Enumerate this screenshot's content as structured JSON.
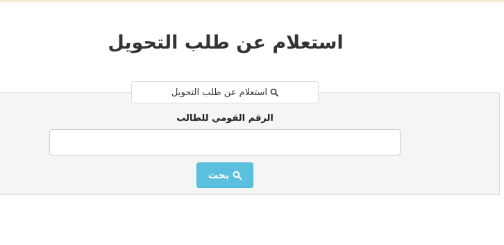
{
  "page": {
    "title": "استعلام عن طلب التحويل"
  },
  "panel": {
    "tab_label": "استعلام عن طلب التحويل",
    "tab_icon": "search-icon",
    "field_label": "الرقم القومي للطالب",
    "input_value": "",
    "input_placeholder": "",
    "button_label": "بحث",
    "button_icon": "search-icon"
  },
  "colors": {
    "button_bg": "#5bc0de",
    "panel_bg": "#f5f5f5",
    "top_line": "#f3ecd0"
  }
}
